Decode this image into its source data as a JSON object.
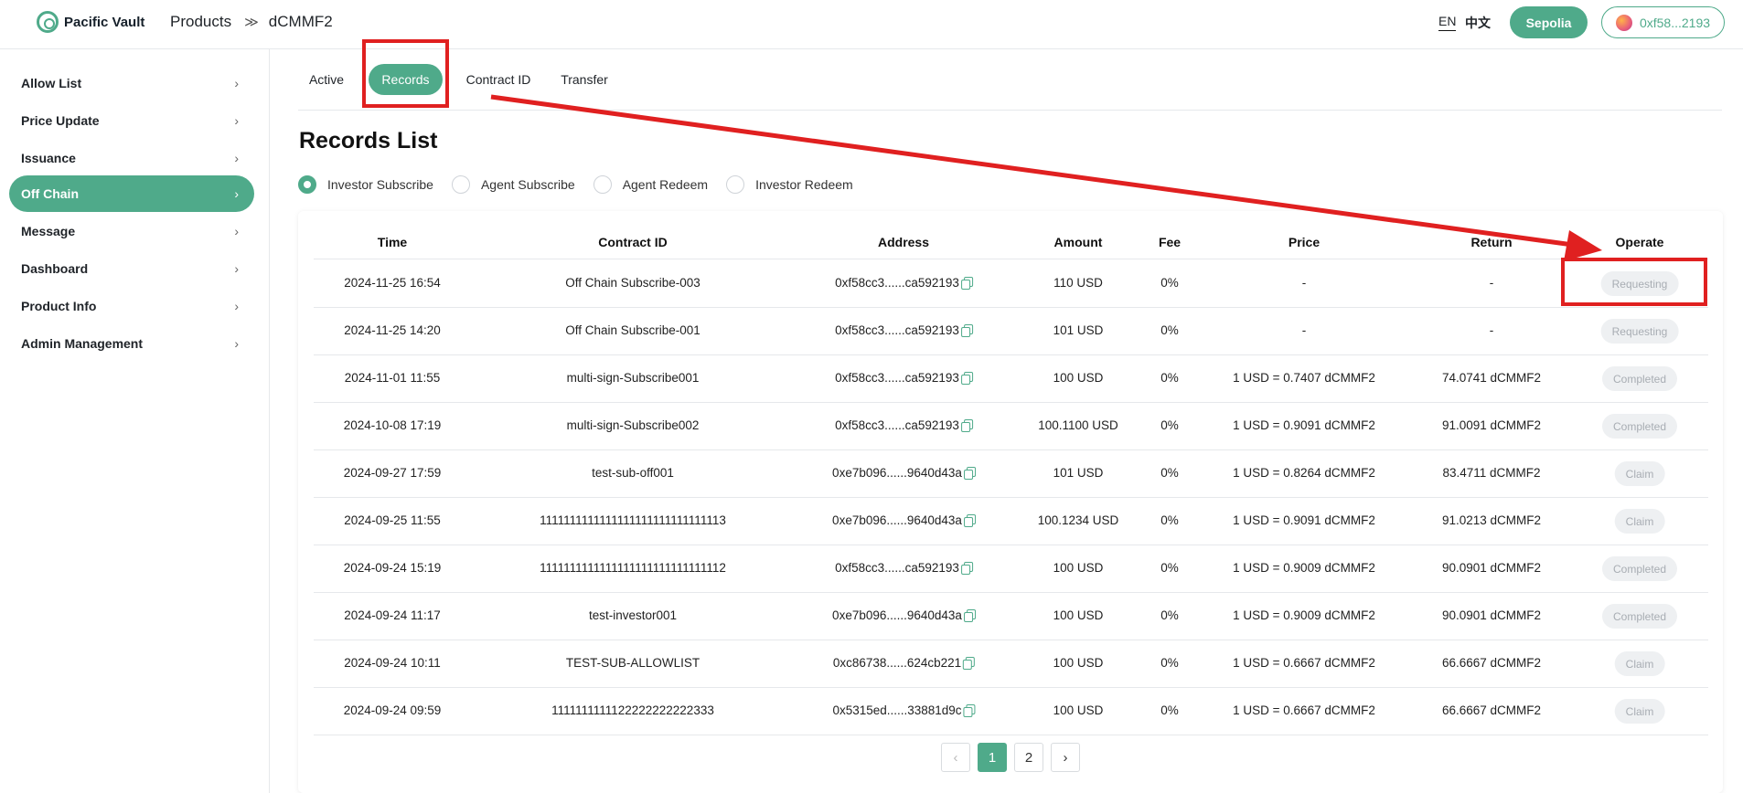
{
  "header": {
    "brand": "Pacific Vault",
    "breadcrumb": [
      "Products",
      "dCMMF2"
    ],
    "breadcrumb_sep": "≫",
    "lang_en": "EN",
    "lang_zh": "中文",
    "network": "Sepolia",
    "wallet": "0xf58...2193"
  },
  "sidebar": {
    "items": [
      {
        "label": "Allow List"
      },
      {
        "label": "Price Update"
      },
      {
        "label": "Issuance"
      },
      {
        "label": "Off Chain",
        "active": true
      },
      {
        "label": "Message"
      },
      {
        "label": "Dashboard"
      },
      {
        "label": "Product Info"
      },
      {
        "label": "Admin Management"
      }
    ]
  },
  "tabs": [
    "Active",
    "Records",
    "Contract ID",
    "Transfer"
  ],
  "active_tab": "Records",
  "page_title": "Records List",
  "filters": [
    "Investor Subscribe",
    "Agent Subscribe",
    "Agent Redeem",
    "Investor Redeem"
  ],
  "selected_filter": "Investor Subscribe",
  "table": {
    "columns": [
      "Time",
      "Contract ID",
      "Address",
      "Amount",
      "Fee",
      "Price",
      "Return",
      "Operate"
    ],
    "rows": [
      {
        "time": "2024-11-25 16:54",
        "contract": "Off Chain Subscribe-003",
        "address": "0xf58cc3......ca592193",
        "amount": "110 USD",
        "fee": "0%",
        "price": "-",
        "return": "-",
        "operate": "Requesting"
      },
      {
        "time": "2024-11-25 14:20",
        "contract": "Off Chain Subscribe-001",
        "address": "0xf58cc3......ca592193",
        "amount": "101 USD",
        "fee": "0%",
        "price": "-",
        "return": "-",
        "operate": "Requesting"
      },
      {
        "time": "2024-11-01 11:55",
        "contract": "multi-sign-Subscribe001",
        "address": "0xf58cc3......ca592193",
        "amount": "100 USD",
        "fee": "0%",
        "price": "1 USD = 0.7407 dCMMF2",
        "return": "74.0741 dCMMF2",
        "operate": "Completed"
      },
      {
        "time": "2024-10-08 17:19",
        "contract": "multi-sign-Subscribe002",
        "address": "0xf58cc3......ca592193",
        "amount": "100.1100 USD",
        "fee": "0%",
        "price": "1 USD = 0.9091 dCMMF2",
        "return": "91.0091 dCMMF2",
        "operate": "Completed"
      },
      {
        "time": "2024-09-27 17:59",
        "contract": "test-sub-off001",
        "address": "0xe7b096......9640d43a",
        "amount": "101 USD",
        "fee": "0%",
        "price": "1 USD = 0.8264 dCMMF2",
        "return": "83.4711 dCMMF2",
        "operate": "Claim"
      },
      {
        "time": "2024-09-25 11:55",
        "contract": "1111111111111111111111111111113",
        "address": "0xe7b096......9640d43a",
        "amount": "100.1234 USD",
        "fee": "0%",
        "price": "1 USD = 0.9091 dCMMF2",
        "return": "91.0213 dCMMF2",
        "operate": "Claim"
      },
      {
        "time": "2024-09-24 15:19",
        "contract": "1111111111111111111111111111112",
        "address": "0xf58cc3......ca592193",
        "amount": "100 USD",
        "fee": "0%",
        "price": "1 USD = 0.9009 dCMMF2",
        "return": "90.0901 dCMMF2",
        "operate": "Completed"
      },
      {
        "time": "2024-09-24 11:17",
        "contract": "test-investor001",
        "address": "0xe7b096......9640d43a",
        "amount": "100 USD",
        "fee": "0%",
        "price": "1 USD = 0.9009 dCMMF2",
        "return": "90.0901 dCMMF2",
        "operate": "Completed"
      },
      {
        "time": "2024-09-24 10:11",
        "contract": "TEST-SUB-ALLOWLIST",
        "address": "0xc86738......624cb221",
        "amount": "100 USD",
        "fee": "0%",
        "price": "1 USD = 0.6667 dCMMF2",
        "return": "66.6667 dCMMF2",
        "operate": "Claim"
      },
      {
        "time": "2024-09-24 09:59",
        "contract": "1111111111122222222222333",
        "address": "0x5315ed......33881d9c",
        "amount": "100 USD",
        "fee": "0%",
        "price": "1 USD = 0.6667 dCMMF2",
        "return": "66.6667 dCMMF2",
        "operate": "Claim"
      }
    ]
  },
  "pagination": {
    "prev": "‹",
    "pages": [
      "1",
      "2"
    ],
    "current": "1",
    "next": "›"
  },
  "colors": {
    "accent": "#4faa8a",
    "annotation": "#e02020"
  }
}
